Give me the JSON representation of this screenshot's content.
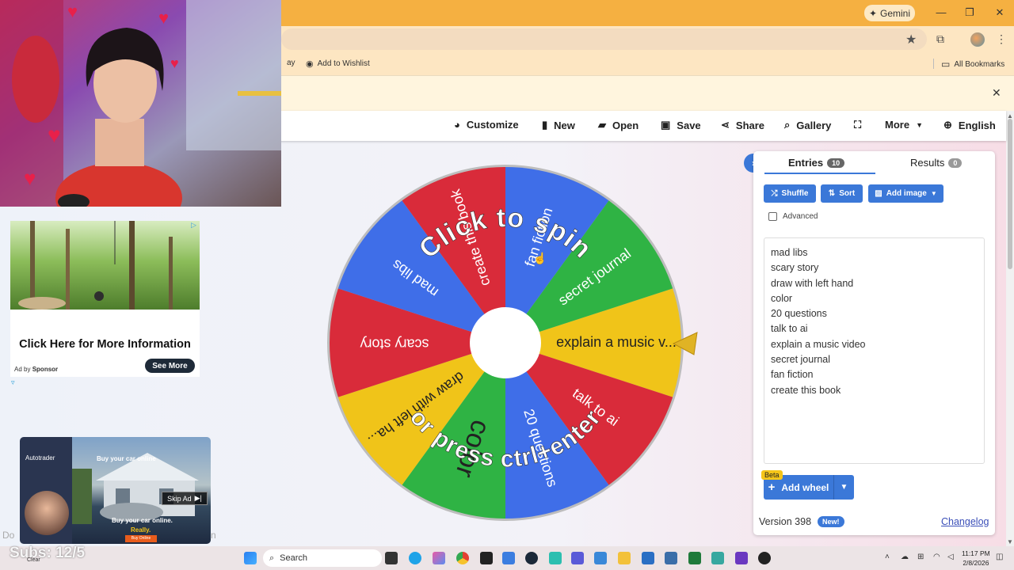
{
  "browser": {
    "gemini_label": "Gemini",
    "bookmarks": {
      "partial_item": "ay",
      "wishlist": "Add to Wishlist",
      "all_bookmarks": "All Bookmarks"
    }
  },
  "toolbar": {
    "customize": "Customize",
    "new": "New",
    "open": "Open",
    "save": "Save",
    "share": "Share",
    "gallery": "Gallery",
    "more": "More",
    "language": "English"
  },
  "wheel": {
    "center_text_top": "Click to spin",
    "center_text_bottom": "or press ctrl+enter",
    "segments": [
      {
        "label": "explain a music v...",
        "color": "#f0c419"
      },
      {
        "label": "talk to ai",
        "color": "#d92b3a"
      },
      {
        "label": "20 questions",
        "color": "#3f6ee8"
      },
      {
        "label": "color",
        "color": "#2fb344"
      },
      {
        "label": "draw with left ha...",
        "color": "#f0c419"
      },
      {
        "label": "scary story",
        "color": "#d92b3a"
      },
      {
        "label": "mad libs",
        "color": "#3f6ee8"
      },
      {
        "label": "create this book",
        "color": "#d92b3a"
      },
      {
        "label": "fan fiction",
        "color": "#3f6ee8"
      },
      {
        "label": "secret journal",
        "color": "#2fb344"
      }
    ]
  },
  "panel": {
    "tab_entries": "Entries",
    "entries_count": "10",
    "tab_results": "Results",
    "results_count": "0",
    "shuffle": "Shuffle",
    "sort": "Sort",
    "add_image": "Add image",
    "advanced": "Advanced",
    "entries": [
      "mad libs",
      "scary story",
      "draw with left hand",
      "color",
      "20 questions",
      "talk to ai",
      "explain a music video",
      "secret journal",
      "fan fiction",
      "create this book"
    ],
    "beta": "Beta",
    "add_wheel": "Add wheel",
    "version": "Version 398",
    "new_badge": "New!",
    "changelog": "Changelog"
  },
  "ads": {
    "ad1_title": "Click Here for More Information",
    "ad1_sponsor_prefix": "Ad by",
    "ad1_sponsor": "Sponsor",
    "ad1_button": "See More",
    "ad2_brand": "Autotrader",
    "ad2_tag1": "Buy your car online",
    "ad2_skip": "Skip Ad",
    "ad2_tag2": "Buy your car online.",
    "ad2_tag3": "Really.",
    "ad2_button": "Buy Online"
  },
  "overlay": {
    "subs": "Subs: 12/5",
    "faint_left": "Do",
    "faint_right": "n",
    "faint_small": "Clear"
  },
  "taskbar": {
    "search": "Search",
    "time": "11:17 PM",
    "date": "2/8/2026"
  }
}
